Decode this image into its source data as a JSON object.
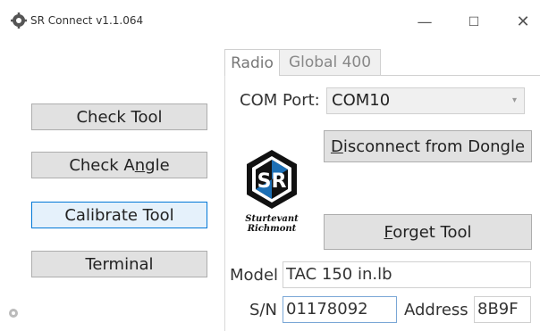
{
  "window": {
    "title": "SR Connect v1.1.064",
    "min_symbol": "—",
    "max_symbol": "☐",
    "close_symbol": "✕"
  },
  "left_buttons": {
    "check_tool": "Check Tool",
    "check_angle_pre": "Check A",
    "check_angle_ul": "n",
    "check_angle_post": "gle",
    "calibrate_tool": "Calibrate Tool",
    "terminal": "Terminal"
  },
  "tabs": {
    "radio": "Radio",
    "global": "Global 400"
  },
  "radio_panel": {
    "com_port_label": "COM Port:",
    "com_port_value": "COM10",
    "disconnect_ul": "D",
    "disconnect_rest": "isconnect from Dongle",
    "forget_ul": "F",
    "forget_rest": "orget Tool",
    "model_label": "Model",
    "model_value": "TAC 150 in.lb",
    "sn_label": "S/N",
    "sn_value": "01178092",
    "address_label": "Address",
    "address_value": "8B9F"
  },
  "logo": {
    "monogram": "SR",
    "line1": "Sturtevant",
    "line2": "Richmont"
  },
  "icons": {
    "app": "gear-icon",
    "status": "gear-icon",
    "combo_arrow": "chevron-down-icon"
  },
  "colors": {
    "focus_border": "#0078d7",
    "button_face": "#e1e1e1",
    "logo_blue": "#1c6fb5"
  }
}
